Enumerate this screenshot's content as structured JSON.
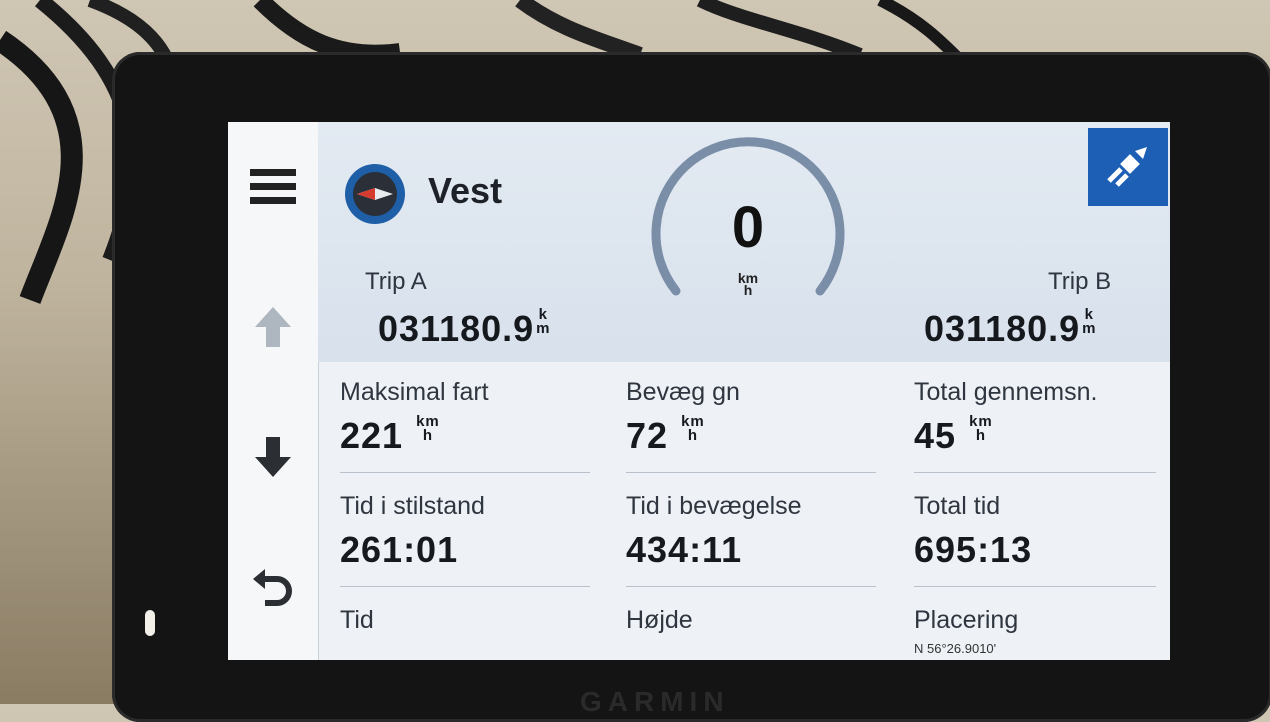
{
  "header": {
    "heading": "Vest",
    "speed": "0",
    "speed_unit_top": "km",
    "speed_unit_bottom": "h"
  },
  "trips": {
    "a": {
      "label": "Trip A",
      "value": "031180.9",
      "unit_top": "k",
      "unit_bottom": "m"
    },
    "b": {
      "label": "Trip B",
      "value": "031180.9",
      "unit_top": "k",
      "unit_bottom": "m"
    }
  },
  "fields": [
    {
      "label": "Maksimal fart",
      "value": "221",
      "unit_top": "km",
      "unit_bottom": "h"
    },
    {
      "label": "Bevæg gn",
      "value": "72",
      "unit_top": "km",
      "unit_bottom": "h"
    },
    {
      "label": "Total gennemsn.",
      "value": "45",
      "unit_top": "km",
      "unit_bottom": "h"
    },
    {
      "label": "Tid i stilstand",
      "value": "261:01"
    },
    {
      "label": "Tid i bevægelse",
      "value": "434:11"
    },
    {
      "label": "Total tid",
      "value": "695:13"
    },
    {
      "label": "Tid",
      "value": ""
    },
    {
      "label": "Højde",
      "value": ""
    },
    {
      "label": "Placering",
      "value": "N 56°26.9010'"
    }
  ],
  "device": {
    "brand": "GARMIN"
  },
  "icons": {
    "menu": "hamburger-icon",
    "up": "arrow-up-icon",
    "down": "arrow-down-icon",
    "back": "back-icon",
    "compass": "compass-icon",
    "satellite": "satellite-icon"
  },
  "colors": {
    "accent": "#1d5fb5",
    "gauge": "#7a8ea8"
  }
}
